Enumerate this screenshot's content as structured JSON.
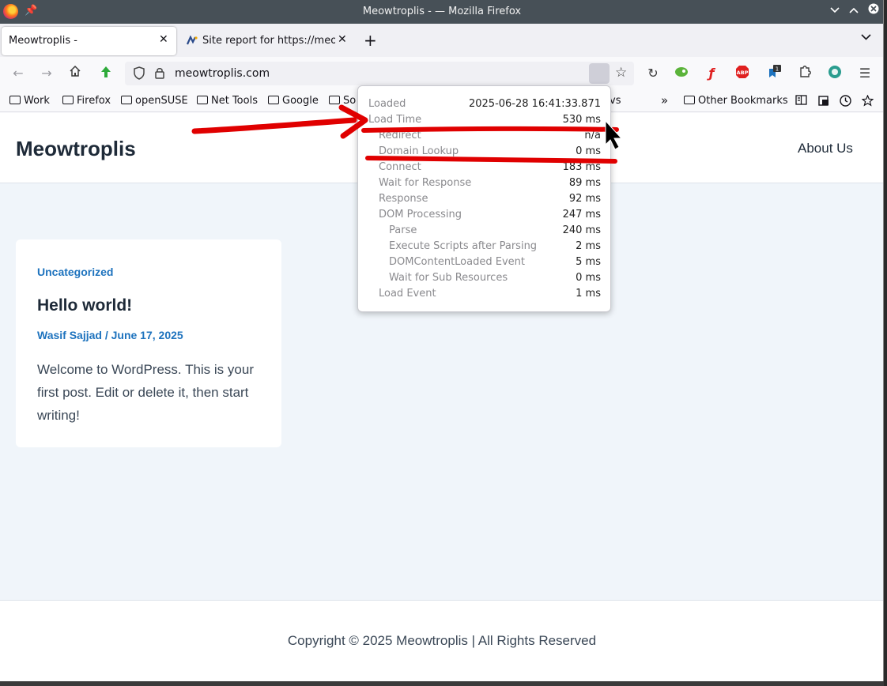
{
  "window": {
    "title": "Meowtroplis - — Mozilla Firefox"
  },
  "tabs": [
    {
      "label": "Meowtroplis -",
      "active": true
    },
    {
      "label": "Site report for https://meo",
      "active": false
    }
  ],
  "urlbar": {
    "url": "meowtroplis.com"
  },
  "bookmarks": {
    "items": [
      "Work",
      "Firefox",
      "openSUSE",
      "Net Tools",
      "Google",
      "So"
    ],
    "overflow_tail": "vs",
    "other": "Other Bookmarks"
  },
  "extensions": {
    "abp_label": "ABP",
    "badge_count": "1"
  },
  "site": {
    "title": "Meowtroplis",
    "nav_about": "About Us",
    "post": {
      "category": "Uncategorized",
      "title": "Hello world!",
      "meta": "Wasif Sajjad / June 17, 2025",
      "excerpt": "Welcome to WordPress. This is your first post. Edit or delete it, then start writing!"
    },
    "footer": "Copyright © 2025 Meowtroplis | All Rights Reserved"
  },
  "timing": {
    "rows": [
      {
        "label": "Loaded",
        "value": "2025-06-28 16:41:33.871",
        "indent": 0
      },
      {
        "label": "Load Time",
        "value": "530 ms",
        "indent": 0
      },
      {
        "label": "Redirect",
        "value": "n/a",
        "indent": 1
      },
      {
        "label": "Domain Lookup",
        "value": "0 ms",
        "indent": 1
      },
      {
        "label": "Connect",
        "value": "183 ms",
        "indent": 1
      },
      {
        "label": "Wait for Response",
        "value": "89 ms",
        "indent": 1
      },
      {
        "label": "Response",
        "value": "92 ms",
        "indent": 1
      },
      {
        "label": "DOM Processing",
        "value": "247 ms",
        "indent": 1
      },
      {
        "label": "Parse",
        "value": "240 ms",
        "indent": 2
      },
      {
        "label": "Execute Scripts after Parsing",
        "value": "2 ms",
        "indent": 2
      },
      {
        "label": "DOMContentLoaded Event",
        "value": "5 ms",
        "indent": 2
      },
      {
        "label": "Wait for Sub Resources",
        "value": "0 ms",
        "indent": 2
      },
      {
        "label": "Load Event",
        "value": "1 ms",
        "indent": 1
      }
    ]
  },
  "colors": {
    "annotation": "#e00000",
    "link": "#1e73be",
    "titlebar": "#475057"
  },
  "icons": [
    "firefox-logo-icon",
    "pin-icon",
    "back-icon",
    "forward-icon",
    "home-icon",
    "recycle-icon",
    "shield-icon",
    "lock-icon",
    "star-icon",
    "reload-icon",
    "mouse-pointer-icon"
  ]
}
